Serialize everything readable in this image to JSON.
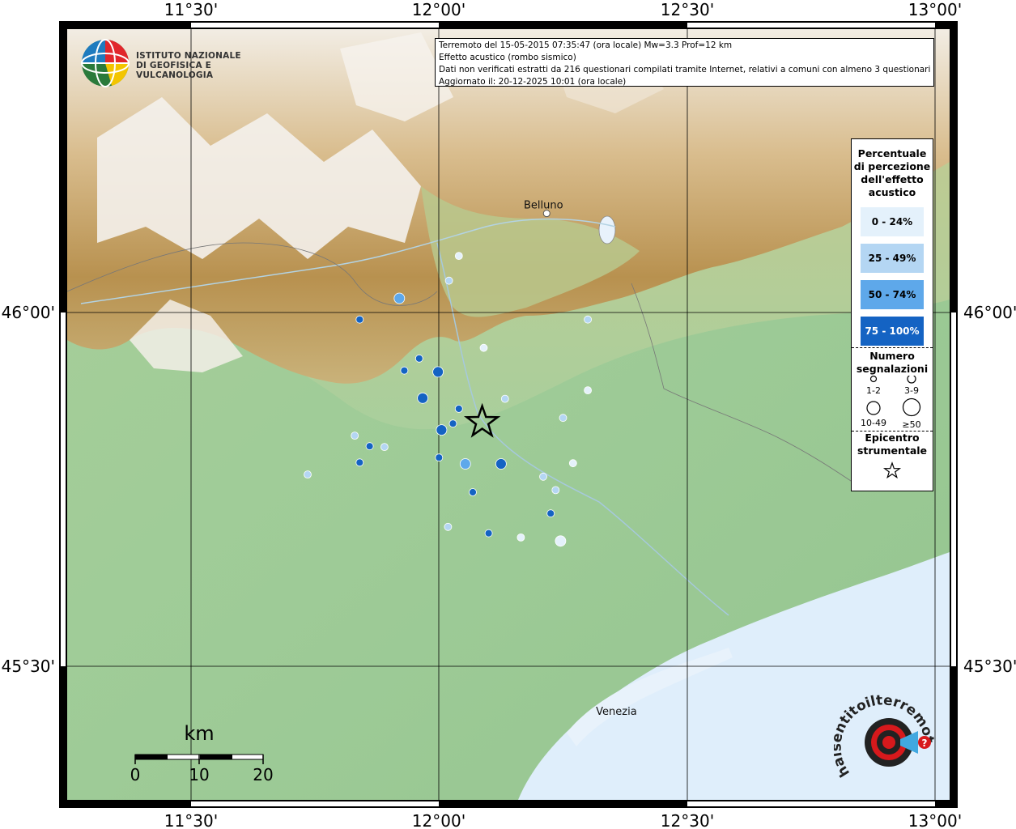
{
  "info": {
    "line1": "Terremoto del 15-05-2015 07:35:47 (ora locale) Mw=3.3 Prof=12 km",
    "line2": "Effetto acustico (rombo sismico)",
    "line3": "Dati non verificati estratti da 216 questionari compilati tramite Internet, relativi a comuni con almeno 3 questionari.",
    "line4": "Aggiornato il: 20-12-2025 10:01 (ora locale)"
  },
  "logo": {
    "line1": "ISTITUTO NAZIONALE",
    "line2": "DI GEOFISICA E VULCANOLOGIA"
  },
  "hst_logo": {
    "text": "haisentitoilterremoto.it",
    "accent": "#d7191c"
  },
  "axes": {
    "lon_labels": [
      "11°30'",
      "12°00'",
      "12°30'",
      "13°00'"
    ],
    "lat_labels": [
      "46°00'",
      "45°30'"
    ]
  },
  "cities": [
    {
      "name": "Belluno",
      "lon": 12.217,
      "lat": 46.14
    },
    {
      "name": "Venezia",
      "lon": 12.338,
      "lat": 45.438
    }
  ],
  "scale_bar": {
    "unit": "km",
    "labels": [
      "0",
      "10",
      "20"
    ]
  },
  "legend": {
    "title": "Percentuale di percezione dell'effetto acustico",
    "title_lines": [
      "Percentuale",
      "di percezione",
      "dell'effetto",
      "acustico"
    ],
    "classes": [
      {
        "label": "0 - 24%",
        "color": "#e4f1fb"
      },
      {
        "label": "25 - 49%",
        "color": "#b4d6f3"
      },
      {
        "label": "50 - 74%",
        "color": "#5ea8ea"
      },
      {
        "label": "75 - 100%",
        "color": "#1463c3"
      }
    ],
    "count_title_lines": [
      "Numero",
      "segnalazioni"
    ],
    "count_classes": [
      "1-2",
      "3-9",
      "10-49",
      "≥50"
    ],
    "epicenter_title_lines": [
      "Epicentro",
      "strumentale"
    ]
  },
  "epicenter": {
    "lon": 12.087,
    "lat": 45.845
  },
  "chart_data": {
    "type": "scatter",
    "title": "Terremoto del 15-05-2015 07:35:47 (ora locale) Mw=3.3 Prof=12 km",
    "xlim": [
      11.25,
      13.0
    ],
    "ylim": [
      45.3,
      46.4
    ],
    "points": [
      {
        "lon": 12.04,
        "lat": 46.08,
        "cls": 0,
        "size": 1
      },
      {
        "lon": 12.02,
        "lat": 46.045,
        "cls": 1,
        "size": 1
      },
      {
        "lon": 11.92,
        "lat": 46.02,
        "cls": 2,
        "size": 2
      },
      {
        "lon": 11.84,
        "lat": 45.99,
        "cls": 3,
        "size": 1
      },
      {
        "lon": 12.3,
        "lat": 45.99,
        "cls": 1,
        "size": 1
      },
      {
        "lon": 12.09,
        "lat": 45.95,
        "cls": 0,
        "size": 1
      },
      {
        "lon": 11.96,
        "lat": 45.935,
        "cls": 3,
        "size": 1
      },
      {
        "lon": 11.93,
        "lat": 45.918,
        "cls": 3,
        "size": 1
      },
      {
        "lon": 11.998,
        "lat": 45.916,
        "cls": 3,
        "size": 2
      },
      {
        "lon": 12.3,
        "lat": 45.89,
        "cls": 0,
        "size": 1
      },
      {
        "lon": 11.967,
        "lat": 45.879,
        "cls": 3,
        "size": 2
      },
      {
        "lon": 12.133,
        "lat": 45.878,
        "cls": 1,
        "size": 1
      },
      {
        "lon": 12.04,
        "lat": 45.864,
        "cls": 3,
        "size": 1
      },
      {
        "lon": 12.25,
        "lat": 45.851,
        "cls": 1,
        "size": 1
      },
      {
        "lon": 12.028,
        "lat": 45.843,
        "cls": 3,
        "size": 1
      },
      {
        "lon": 12.005,
        "lat": 45.834,
        "cls": 3,
        "size": 2
      },
      {
        "lon": 11.83,
        "lat": 45.826,
        "cls": 1,
        "size": 1
      },
      {
        "lon": 11.86,
        "lat": 45.811,
        "cls": 3,
        "size": 1
      },
      {
        "lon": 11.89,
        "lat": 45.81,
        "cls": 1,
        "size": 1
      },
      {
        "lon": 12.0,
        "lat": 45.795,
        "cls": 3,
        "size": 1
      },
      {
        "lon": 11.84,
        "lat": 45.788,
        "cls": 3,
        "size": 1
      },
      {
        "lon": 12.053,
        "lat": 45.786,
        "cls": 2,
        "size": 2
      },
      {
        "lon": 12.125,
        "lat": 45.786,
        "cls": 3,
        "size": 2
      },
      {
        "lon": 12.27,
        "lat": 45.787,
        "cls": 0,
        "size": 1
      },
      {
        "lon": 11.735,
        "lat": 45.771,
        "cls": 1,
        "size": 1
      },
      {
        "lon": 12.21,
        "lat": 45.768,
        "cls": 1,
        "size": 1
      },
      {
        "lon": 12.235,
        "lat": 45.749,
        "cls": 1,
        "size": 1
      },
      {
        "lon": 12.068,
        "lat": 45.746,
        "cls": 3,
        "size": 1
      },
      {
        "lon": 12.225,
        "lat": 45.716,
        "cls": 3,
        "size": 1
      },
      {
        "lon": 12.018,
        "lat": 45.697,
        "cls": 1,
        "size": 1
      },
      {
        "lon": 12.1,
        "lat": 45.688,
        "cls": 3,
        "size": 1
      },
      {
        "lon": 12.165,
        "lat": 45.682,
        "cls": 0,
        "size": 1
      },
      {
        "lon": 12.245,
        "lat": 45.677,
        "cls": 0,
        "size": 2
      }
    ]
  }
}
